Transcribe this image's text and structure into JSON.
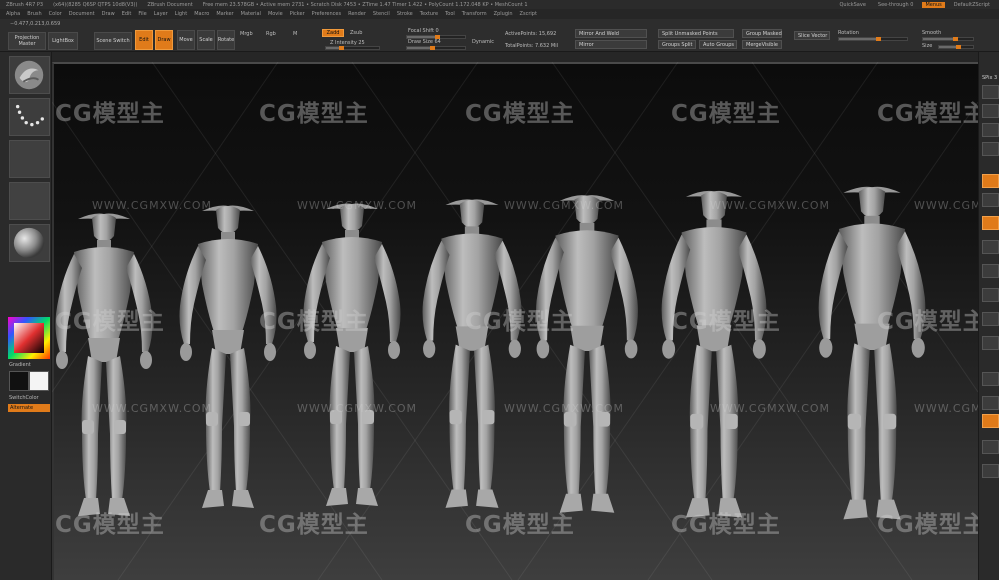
{
  "app": {
    "title": "ZBrush 4R7 P3",
    "title_segments": [
      "ZBrush 4R7 P3",
      "(x64)(8285 Q6SP QTPS 10d8(V3))",
      "ZBrush Document",
      "Free mem 23.578GB • Active mem 2731 • Scratch Disk 7453 • ZTime 1.47 Timer 1.422 • PolyCount 1.172.048 KP • MeshCount 1"
    ],
    "quicksave": "QuickSave",
    "see_through": "See-through 0",
    "menus_label": "Menus",
    "default_script": "DefaultZScript"
  },
  "menu": [
    "Alpha",
    "Brush",
    "Color",
    "Document",
    "Draw",
    "Edit",
    "File",
    "Layer",
    "Light",
    "Macro",
    "Marker",
    "Material",
    "Movie",
    "Picker",
    "Preferences",
    "Render",
    "Stencil",
    "Stroke",
    "Texture",
    "Tool",
    "Transform",
    "Zplugin",
    "Zscript"
  ],
  "shelf": {
    "coords": "−0.477,0.213,0.659",
    "projection_master": "Projection Master",
    "lightbox": "LightBox",
    "scene_switch": "Scene Switch",
    "edit": "Edit",
    "draw": "Draw",
    "move": "Move",
    "scale": "Scale",
    "rotate": "Rotate",
    "mrgb": "Mrgb",
    "rgb": "Rgb",
    "m": "M",
    "zadd": "Zadd",
    "zsub": "Zsub",
    "z_intensity": "Z Intensity 25",
    "focal_shift": "Focal Shift 0",
    "draw_size": "Draw Size 64",
    "dynamic": "Dynamic",
    "active_points": "ActivePoints: 15,692",
    "total_points": "TotalPoints: 7.632 Mil",
    "mirror_weld": "Mirror And Weld",
    "mirror": "Mirror",
    "split_unmasked": "Split Unmasked Points",
    "groups_split": "Groups Split",
    "auto_groups": "Auto Groups",
    "merge_visible": "MergeVisible",
    "group_masked": "Group Masked",
    "slice_label": "Slice Vector",
    "rotation": "Rotation",
    "smooth": "Smooth",
    "size": "Size"
  },
  "left_tray": {
    "gradient_label": "Gradient",
    "switch_color": "SwitchColor",
    "alternate": "Alternate"
  },
  "right_tray": {
    "label": "SPix 3"
  },
  "watermark": {
    "brand": "CG模型主",
    "url": "WWW.CGMXW.COM"
  },
  "colors": {
    "accent": "#e07b1a",
    "primary_color": "#ffffff",
    "secondary_color": "#111111"
  }
}
